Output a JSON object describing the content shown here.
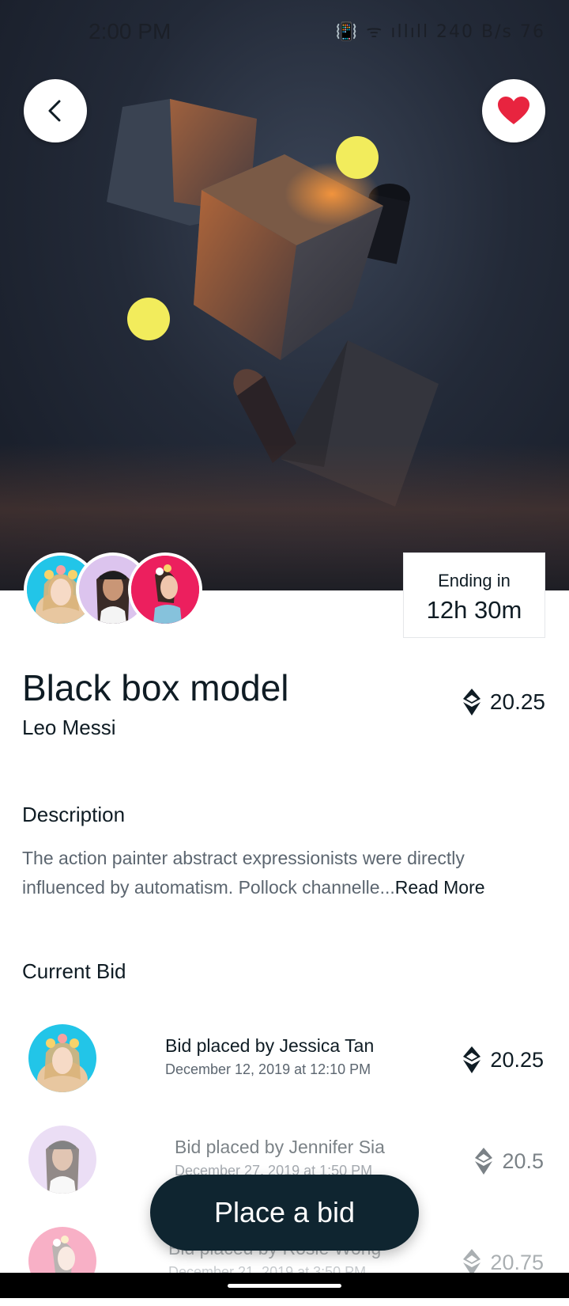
{
  "status_bar": {
    "time": "2:00 PM",
    "icons": "📳 ᯤ ıllıll 240 B/s 76"
  },
  "hero": {
    "image": "abstract-3d-cubes-artwork"
  },
  "ending": {
    "label": "Ending in",
    "value": "12h 30m"
  },
  "item": {
    "title": "Black box model",
    "artist": "Leo Messi",
    "price": "20.25",
    "currency_icon": "ethereum-icon"
  },
  "description": {
    "heading": "Description",
    "text": "The action painter abstract expressionists were directly influenced by automatism. Pollock channelle...",
    "read_more": "Read More"
  },
  "current_bid": {
    "heading": "Current Bid",
    "bids": [
      {
        "title": "Bid placed by Jessica Tan",
        "date": "December 12, 2019 at 12:10 PM",
        "price": "20.25"
      },
      {
        "title": "Bid placed by Jennifer Sia",
        "date": "December 27, 2019 at 1:50 PM",
        "price": "20.5"
      },
      {
        "title": "Bid placed by Rosie Wong",
        "date": "December 21, 2019 at 3:50 PM",
        "price": "20.75"
      }
    ]
  },
  "actions": {
    "place_bid": "Place a bid"
  },
  "colors": {
    "primary_dark": "#0f2530",
    "heart_red": "#e8243f",
    "accent_yellow": "#f2ec5c"
  }
}
